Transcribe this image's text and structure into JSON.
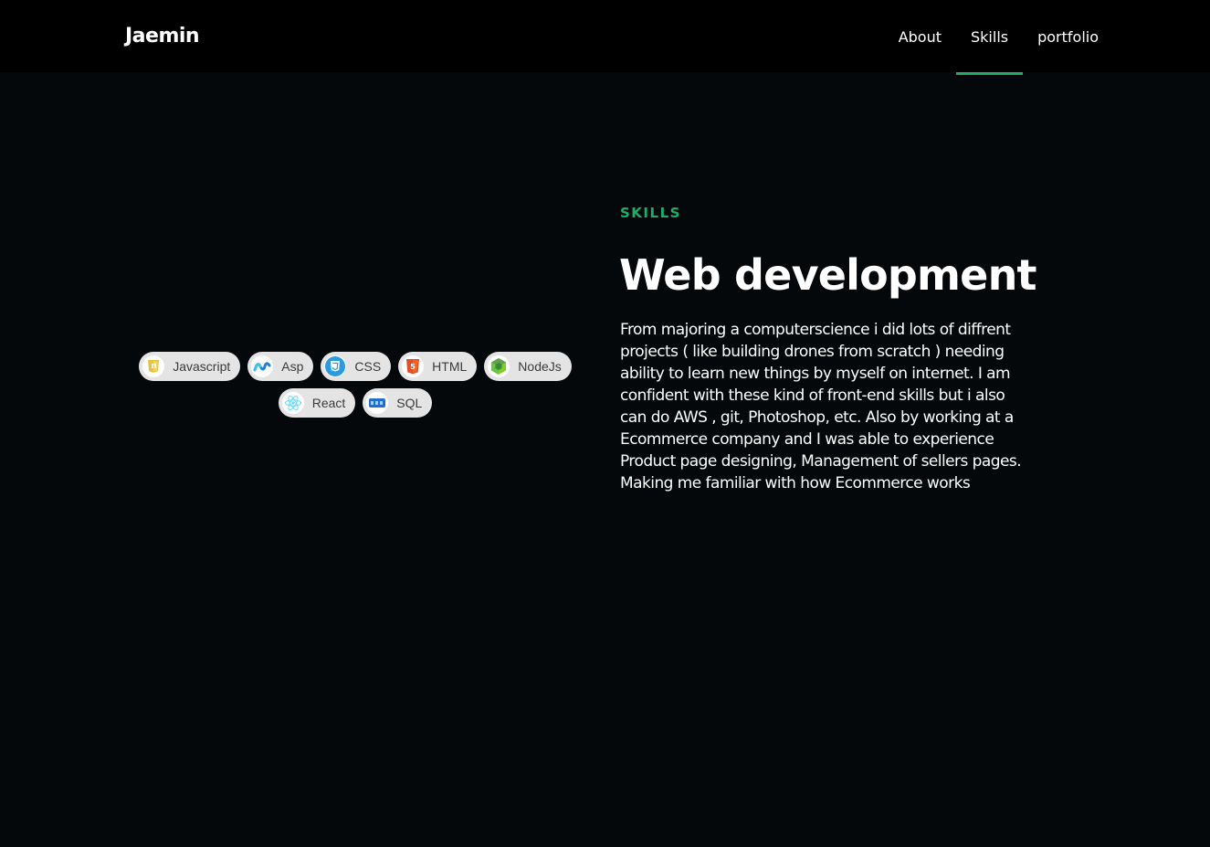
{
  "header": {
    "brand": "Jaemin",
    "nav": [
      {
        "label": "About",
        "active": false
      },
      {
        "label": "Skills",
        "active": true
      },
      {
        "label": "portfolio",
        "active": false
      }
    ]
  },
  "skills": {
    "chips": [
      {
        "label": "Javascript",
        "icon": "javascript-icon"
      },
      {
        "label": "Asp",
        "icon": "asp-icon"
      },
      {
        "label": "CSS",
        "icon": "css-icon"
      },
      {
        "label": "HTML",
        "icon": "html-icon"
      },
      {
        "label": "NodeJs",
        "icon": "nodejs-icon"
      },
      {
        "label": "React",
        "icon": "react-icon"
      },
      {
        "label": "SQL",
        "icon": "sql-icon"
      }
    ]
  },
  "section": {
    "eyebrow": "SKILLS",
    "title": "Web development",
    "body": "From majoring a computerscience i did lots of diffrent projects ( like building drones from scratch ) needing ability to learn new things by myself on internet. I am confident with these kind of front-end skills but i also can do AWS , git, Photoshop, etc. Also by working at a Ecommerce company and I was able to experience Product page designing, Management of sellers pages. Making me familiar with how Ecommerce works"
  },
  "colors": {
    "accent": "#1fae6a",
    "background": "#05080a",
    "header": "#000000",
    "chip": "#e4e4e4"
  }
}
